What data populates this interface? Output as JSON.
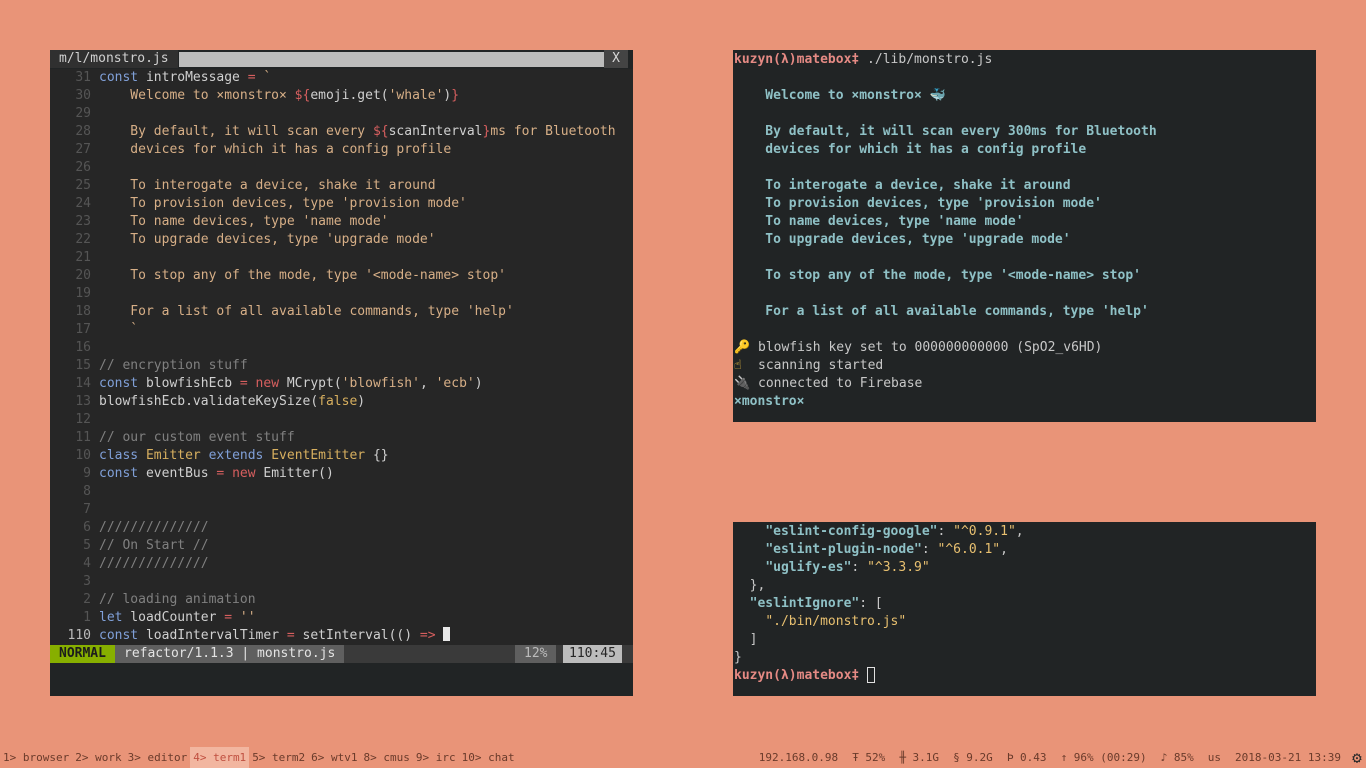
{
  "vim": {
    "tab_title": "m/l/monstro.js",
    "close_label": "X",
    "lines": [
      {
        "n": "31",
        "segs": [
          [
            "kw",
            "const"
          ],
          [
            "tx",
            " introMessage "
          ],
          [
            "op",
            "="
          ],
          [
            "tx",
            " "
          ],
          [
            "st",
            "`"
          ]
        ]
      },
      {
        "n": "30",
        "segs": [
          [
            "st",
            "    Welcome to ×monstro× "
          ],
          [
            "op",
            "${"
          ],
          [
            "tx",
            "emoji.get("
          ],
          [
            "st",
            "'whale'"
          ],
          [
            "tx",
            ")"
          ],
          [
            "op",
            "}"
          ]
        ]
      },
      {
        "n": "29",
        "segs": []
      },
      {
        "n": "28",
        "segs": [
          [
            "st",
            "    By default, it will scan every "
          ],
          [
            "op",
            "${"
          ],
          [
            "tx",
            "scanInterval"
          ],
          [
            "op",
            "}"
          ],
          [
            "st",
            "ms for Bluetooth"
          ]
        ]
      },
      {
        "n": "27",
        "segs": [
          [
            "st",
            "    devices for which it has a config profile"
          ]
        ]
      },
      {
        "n": "26",
        "segs": []
      },
      {
        "n": "25",
        "segs": [
          [
            "st",
            "    To interogate a device, shake it around"
          ]
        ]
      },
      {
        "n": "24",
        "segs": [
          [
            "st",
            "    To provision devices, type 'provision mode'"
          ]
        ]
      },
      {
        "n": "23",
        "segs": [
          [
            "st",
            "    To name devices, type 'name mode'"
          ]
        ]
      },
      {
        "n": "22",
        "segs": [
          [
            "st",
            "    To upgrade devices, type 'upgrade mode'"
          ]
        ]
      },
      {
        "n": "21",
        "segs": []
      },
      {
        "n": "20",
        "segs": [
          [
            "st",
            "    To stop any of the mode, type '<mode-name> stop'"
          ]
        ]
      },
      {
        "n": "19",
        "segs": []
      },
      {
        "n": "18",
        "segs": [
          [
            "st",
            "    For a list of all available commands, type 'help'"
          ]
        ]
      },
      {
        "n": "17",
        "segs": [
          [
            "st",
            "    `"
          ]
        ]
      },
      {
        "n": "16",
        "segs": []
      },
      {
        "n": "15",
        "segs": [
          [
            "co",
            "// encryption stuff"
          ]
        ]
      },
      {
        "n": "14",
        "segs": [
          [
            "kw",
            "const"
          ],
          [
            "tx",
            " blowfishEcb "
          ],
          [
            "op",
            "="
          ],
          [
            "tx",
            " "
          ],
          [
            "op",
            "new"
          ],
          [
            "tx",
            " MCrypt("
          ],
          [
            "st",
            "'blowfish'"
          ],
          [
            "tx",
            ", "
          ],
          [
            "st",
            "'ecb'"
          ],
          [
            "tx",
            ")"
          ]
        ]
      },
      {
        "n": "13",
        "segs": [
          [
            "tx",
            "blowfishEcb.validateKeySize("
          ],
          [
            "ty",
            "false"
          ],
          [
            "tx",
            ")"
          ]
        ]
      },
      {
        "n": "12",
        "segs": []
      },
      {
        "n": "11",
        "segs": [
          [
            "co",
            "// our custom event stuff"
          ]
        ]
      },
      {
        "n": "10",
        "segs": [
          [
            "kw",
            "class"
          ],
          [
            "tx",
            " "
          ],
          [
            "ty",
            "Emitter"
          ],
          [
            "tx",
            " "
          ],
          [
            "kw",
            "extends"
          ],
          [
            "tx",
            " "
          ],
          [
            "ty",
            "EventEmitter"
          ],
          [
            "tx",
            " {}"
          ]
        ]
      },
      {
        "n": "9",
        "segs": [
          [
            "kw",
            "const"
          ],
          [
            "tx",
            " eventBus "
          ],
          [
            "op",
            "="
          ],
          [
            "tx",
            " "
          ],
          [
            "op",
            "new"
          ],
          [
            "tx",
            " Emitter()"
          ]
        ]
      },
      {
        "n": "8",
        "segs": []
      },
      {
        "n": "7",
        "segs": []
      },
      {
        "n": "6",
        "segs": [
          [
            "co",
            "//////////////"
          ]
        ]
      },
      {
        "n": "5",
        "segs": [
          [
            "co",
            "// On Start //"
          ]
        ]
      },
      {
        "n": "4",
        "segs": [
          [
            "co",
            "//////////////"
          ]
        ]
      },
      {
        "n": "3",
        "segs": []
      },
      {
        "n": "2",
        "segs": [
          [
            "co",
            "// loading animation"
          ]
        ]
      },
      {
        "n": "1",
        "segs": [
          [
            "kw",
            "let"
          ],
          [
            "tx",
            " loadCounter "
          ],
          [
            "op",
            "="
          ],
          [
            "tx",
            " "
          ],
          [
            "st",
            "''"
          ]
        ]
      },
      {
        "n": "110",
        "cur": true,
        "segs": [
          [
            "kw",
            "const"
          ],
          [
            "tx",
            " loadIntervalTimer "
          ],
          [
            "op",
            "="
          ],
          [
            "tx",
            " setInterval(() "
          ],
          [
            "op",
            "=>"
          ],
          [
            "tx",
            " "
          ]
        ]
      }
    ],
    "status": {
      "mode": "NORMAL",
      "branch_file": "refactor/1.1.3 | monstro.js",
      "percent": "12%",
      "position": "110:45"
    }
  },
  "term1": {
    "prompt_user": "kuzyn(λ)matebox",
    "prompt_sym": "‡",
    "command": " ./lib/monstro.js",
    "output": [
      "",
      "    Welcome to ×monstro× 🐳",
      "",
      "    By default, it will scan every 300ms for Bluetooth",
      "    devices for which it has a config profile",
      "",
      "    To interogate a device, shake it around",
      "    To provision devices, type 'provision mode'",
      "    To name devices, type 'name mode'",
      "    To upgrade devices, type 'upgrade mode'",
      "",
      "    To stop any of the mode, type '<mode-name> stop'",
      "",
      "    For a list of all available commands, type 'help'",
      ""
    ],
    "logs": [
      {
        "icon": "key-icon",
        "glyph": "🔑",
        "cls": "key-ic",
        "text": "blowfish key set to 000000000000 (SpO2_v6HD)"
      },
      {
        "icon": "pointing-hand-icon",
        "glyph": "☝",
        "cls": "hand-ic",
        "text": "scanning started"
      },
      {
        "icon": "plug-icon",
        "glyph": "🔌",
        "cls": "plug-ic",
        "text": "connected to Firebase"
      }
    ],
    "repl_prompt": "×monstro×"
  },
  "term2": {
    "json_lines": [
      {
        "indent": "    ",
        "key": "\"eslint-config-google\"",
        "val": "\"^0.9.1\"",
        "tail": ","
      },
      {
        "indent": "    ",
        "key": "\"eslint-plugin-node\"",
        "val": "\"^6.0.1\"",
        "tail": ","
      },
      {
        "indent": "    ",
        "key": "\"uglify-es\"",
        "val": "\"^3.3.9\"",
        "tail": ""
      },
      {
        "indent": "  ",
        "plain": "},"
      },
      {
        "indent": "  ",
        "key": "\"eslintIgnore\"",
        "tail": ": ["
      },
      {
        "indent": "    ",
        "val": "\"./bin/monstro.js\"",
        "tail": ""
      },
      {
        "indent": "  ",
        "plain": "]"
      },
      {
        "indent": "",
        "plain": "}"
      }
    ],
    "prompt_user": "kuzyn(λ)matebox",
    "prompt_sym": "‡"
  },
  "bottombar": {
    "workspaces": [
      {
        "label": "1> browser",
        "active": false
      },
      {
        "label": "2> work",
        "active": false
      },
      {
        "label": "3> editor",
        "active": false
      },
      {
        "label": "4> term1",
        "active": true
      },
      {
        "label": "5> term2",
        "active": false
      },
      {
        "label": "6> wtv1",
        "active": false
      },
      {
        "label": "8> cmus",
        "active": false
      },
      {
        "label": "9> irc",
        "active": false
      },
      {
        "label": "10> chat",
        "active": false
      }
    ],
    "ip": "192.168.0.98",
    "cpu": "Ŧ 52%",
    "mem": "╫ 3.1G",
    "disk": "§ 9.2G",
    "load": "Þ 0.43",
    "battery": "↑ 96% (00:29)",
    "volume": "♪ 85%",
    "layout": "us",
    "datetime": "2018-03-21 13:39"
  }
}
